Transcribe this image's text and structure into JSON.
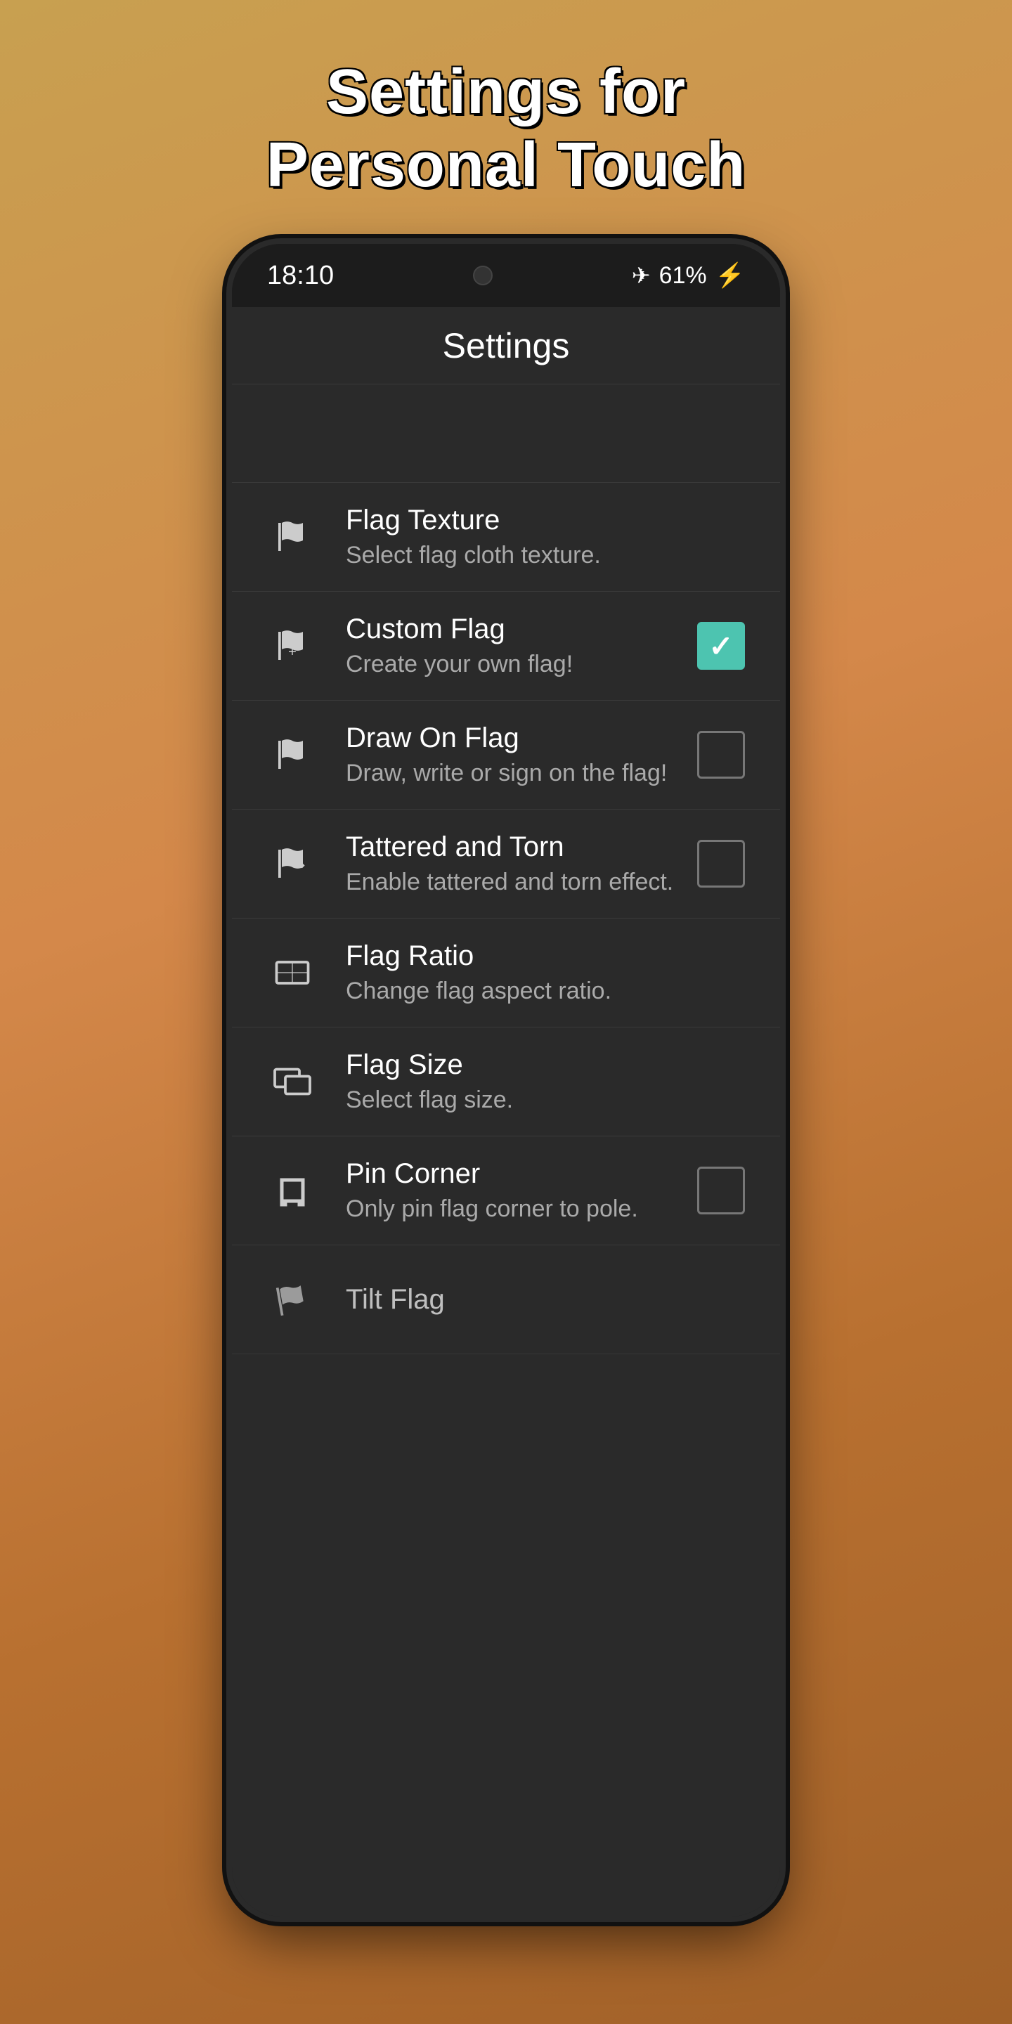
{
  "page": {
    "title_line1": "Settings for",
    "title_line2": "Personal Touch"
  },
  "statusBar": {
    "time": "18:10",
    "battery": "61%",
    "batteryIcon": "⚡"
  },
  "topBar": {
    "title": "Settings"
  },
  "settings": {
    "items": [
      {
        "id": "flag-texture",
        "icon": "flag-texture-icon",
        "title": "Flag Texture",
        "subtitle": "Select flag cloth texture.",
        "hasCheckbox": false
      },
      {
        "id": "custom-flag",
        "icon": "custom-flag-icon",
        "title": "Custom Flag",
        "subtitle": "Create your own flag!",
        "hasCheckbox": true,
        "checked": true
      },
      {
        "id": "draw-on-flag",
        "icon": "draw-on-flag-icon",
        "title": "Draw On Flag",
        "subtitle": "Draw, write or sign on the flag!",
        "hasCheckbox": true,
        "checked": false
      },
      {
        "id": "tattered-and-torn",
        "icon": "tattered-torn-icon",
        "title": "Tattered and Torn",
        "subtitle": "Enable tattered and torn effect.",
        "hasCheckbox": true,
        "checked": false
      },
      {
        "id": "flag-ratio",
        "icon": "flag-ratio-icon",
        "title": "Flag Ratio",
        "subtitle": "Change flag aspect ratio.",
        "hasCheckbox": false
      },
      {
        "id": "flag-size",
        "icon": "flag-size-icon",
        "title": "Flag Size",
        "subtitle": "Select flag size.",
        "hasCheckbox": false
      },
      {
        "id": "pin-corner",
        "icon": "pin-corner-icon",
        "title": "Pin Corner",
        "subtitle": "Only pin flag corner to pole.",
        "hasCheckbox": true,
        "checked": false
      },
      {
        "id": "tilt-flag",
        "icon": "tilt-flag-icon",
        "title": "Tilt Flag",
        "subtitle": "",
        "hasCheckbox": false
      }
    ]
  }
}
